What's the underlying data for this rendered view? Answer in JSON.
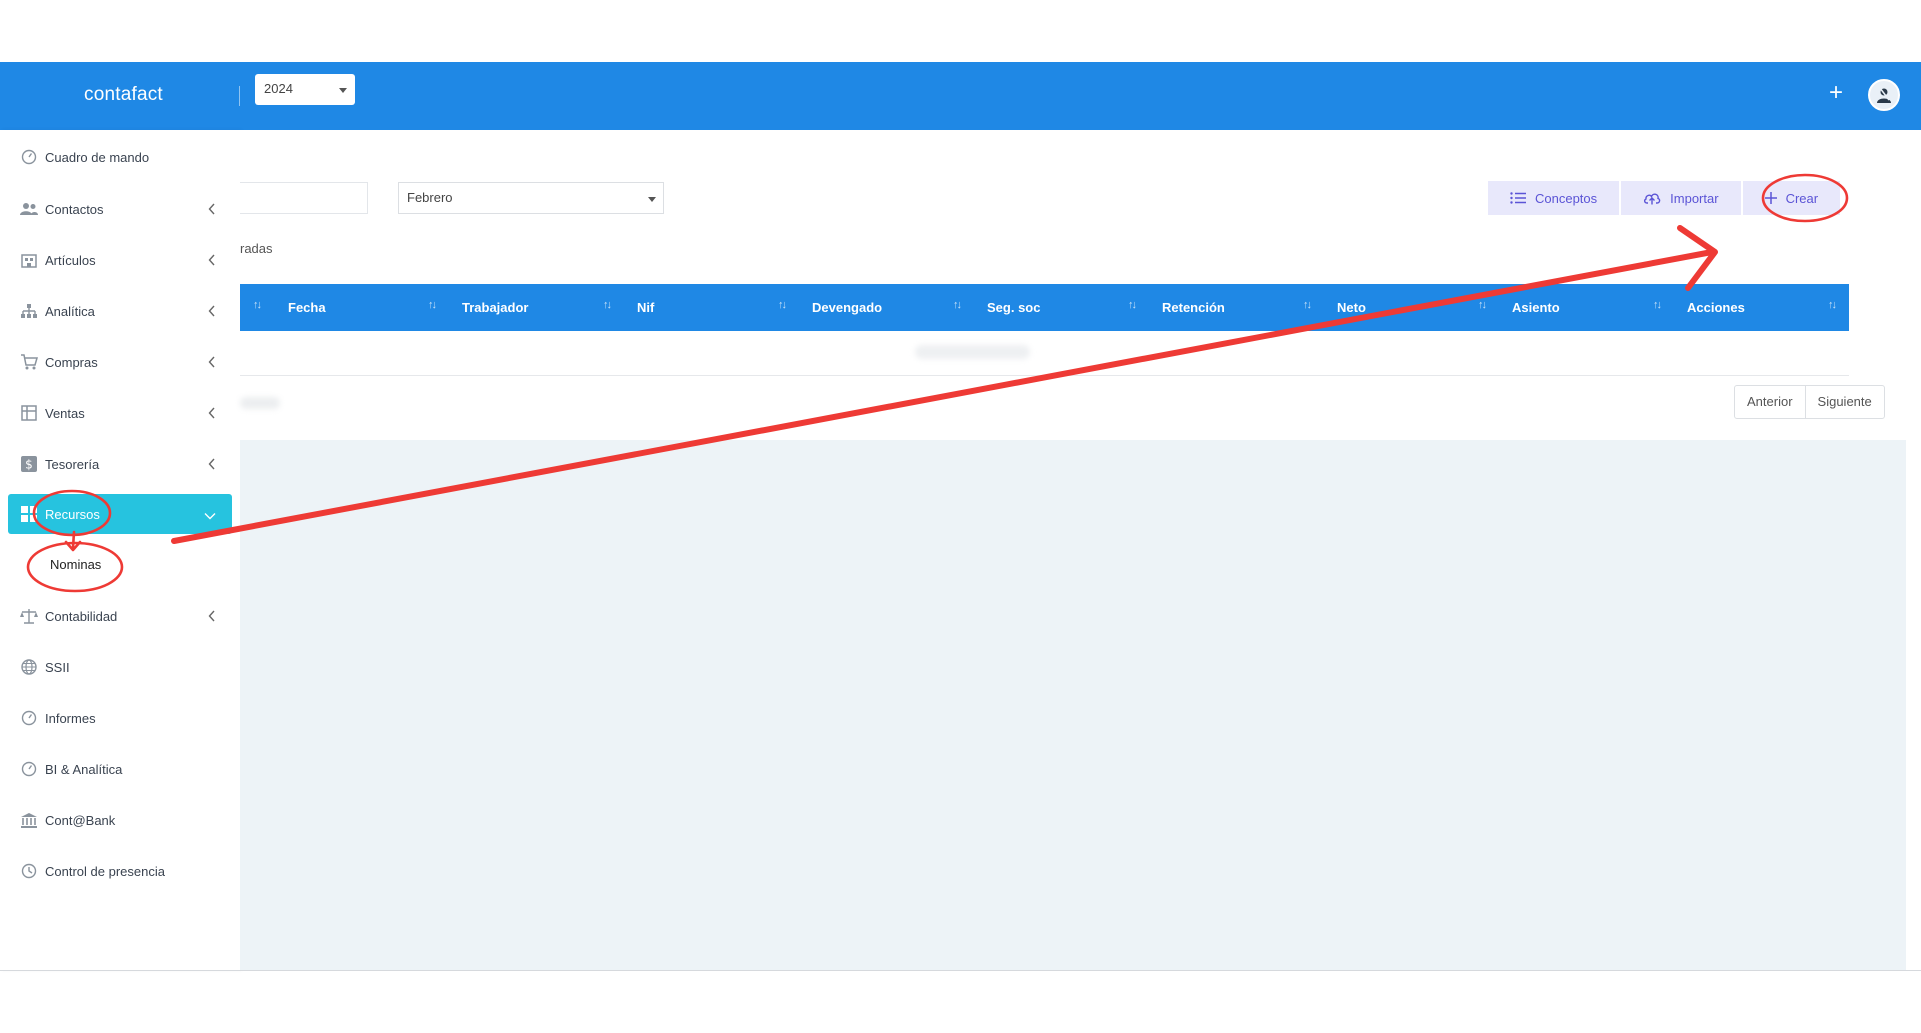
{
  "app": {
    "brand": "contafact",
    "year": "2024"
  },
  "header": {
    "add_label": "+"
  },
  "sidebar": {
    "items": [
      {
        "label": "Cuadro de mando",
        "icon": "dashboard-icon"
      },
      {
        "label": "Contactos",
        "icon": "users-icon"
      },
      {
        "label": "Artículos",
        "icon": "building-icon"
      },
      {
        "label": "Analítica",
        "icon": "hierarchy-icon"
      },
      {
        "label": "Compras",
        "icon": "cart-icon"
      },
      {
        "label": "Ventas",
        "icon": "ventas-icon"
      },
      {
        "label": "Tesorería",
        "icon": "dollar-icon"
      },
      {
        "label": "Recursos",
        "icon": "grid-icon"
      },
      {
        "label": "Contabilidad",
        "icon": "scale-icon"
      },
      {
        "label": "SSII",
        "icon": "globe-icon"
      },
      {
        "label": "Informes",
        "icon": "gauge-icon"
      },
      {
        "label": "BI & Analítica",
        "icon": "gauge-icon"
      },
      {
        "label": "Cont@Bank",
        "icon": "bank-icon"
      },
      {
        "label": "Control de presencia",
        "icon": "clock-icon"
      }
    ],
    "sub_item": "Nominas"
  },
  "filters": {
    "month": "Febrero",
    "partial_label": "radas"
  },
  "actions": {
    "conceptos": "Conceptos",
    "importar": "Importar",
    "crear": "Crear"
  },
  "table": {
    "columns": [
      "Fecha",
      "Trabajador",
      "Nif",
      "Devengado",
      "Seg. soc",
      "Retención",
      "Neto",
      "Asiento",
      "Acciones"
    ]
  },
  "pager": {
    "prev": "Anterior",
    "next": "Siguiente"
  },
  "annotation": {
    "color": "#ee3a35"
  }
}
